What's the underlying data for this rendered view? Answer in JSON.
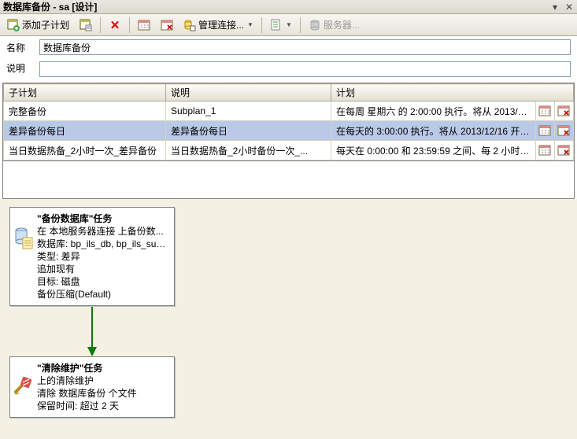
{
  "window": {
    "title": "数据库备份 - sa [设计]"
  },
  "toolbar": {
    "add_subplan": "添加子计划",
    "manage_conn": "管理连接...",
    "servers": "服务器..."
  },
  "form": {
    "name_label": "名称",
    "name_value": "数据库备份",
    "desc_label": "说明",
    "desc_value": ""
  },
  "grid": {
    "headers": {
      "subplan": "子计划",
      "desc": "说明",
      "plan": "计划"
    },
    "rows": [
      {
        "subplan": "完整备份",
        "desc": "Subplan_1",
        "plan": "在每周 星期六 的 2:00:00 执行。将从 2013/12/1...",
        "selected": false
      },
      {
        "subplan": "差异备份每日",
        "desc": "差异备份每日",
        "plan": "在每天的 3:00:00 执行。将从 2013/12/16 开始...",
        "selected": true
      },
      {
        "subplan": "当日数据热备_2小时一次_差异备份",
        "desc": "当日数据热备_2小时备份一次_...",
        "plan": "每天在 0:00:00 和 23:59:59 之间、每 2 小时 执...",
        "selected": false
      }
    ]
  },
  "designer": {
    "task1": {
      "title": "\"备份数据库\"任务",
      "line1": "在 本地服务器连接 上备份数...",
      "line2": "数据库: bp_ils_db, bp_ils_sub_...",
      "line3": "类型: 差异",
      "line4": "追加现有",
      "line5": "目标: 磁盘",
      "line6": "备份压缩(Default)"
    },
    "task2": {
      "title": "\"清除维护\"任务",
      "line1": " 上的清除维护",
      "line2": "清除 数据库备份 个文件",
      "line3": "保留时间: 超过 2 天"
    }
  }
}
